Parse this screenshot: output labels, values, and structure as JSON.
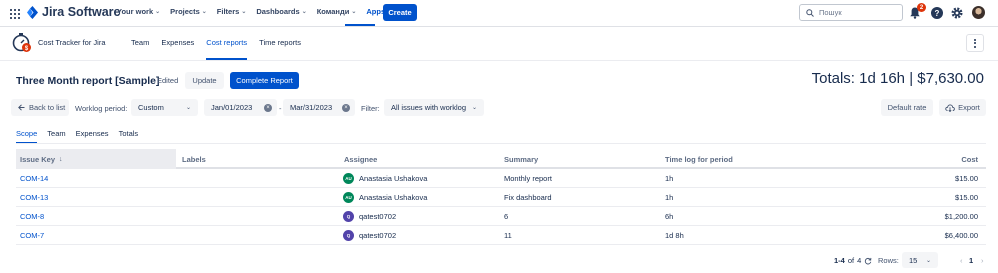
{
  "topnav": {
    "logo": "Jira Software",
    "items": [
      {
        "label": "Your work"
      },
      {
        "label": "Projects"
      },
      {
        "label": "Filters"
      },
      {
        "label": "Dashboards"
      },
      {
        "label": "Команди"
      },
      {
        "label": "Apps"
      }
    ],
    "create_label": "Create",
    "search_placeholder": "Пошук",
    "notif_count": "2",
    "help_glyph": "?"
  },
  "app": {
    "name": "Cost Tracker for Jira",
    "tabs": [
      {
        "label": "Team"
      },
      {
        "label": "Expenses"
      },
      {
        "label": "Cost reports"
      },
      {
        "label": "Time reports"
      }
    ]
  },
  "report": {
    "title": "Three Month report [Sample]",
    "status": "Edited",
    "update_label": "Update",
    "complete_label": "Complete Report",
    "totals": "Totals: 1d 16h | $7,630.00"
  },
  "filters": {
    "back_label": "Back to list",
    "worklog_label": "Worklog period:",
    "period_value": "Custom",
    "date_from": "Jan/01/2023",
    "date_sep": "-",
    "date_to": "Mar/31/2023",
    "filter_label": "Filter:",
    "filter_value": "All issues with worklog",
    "default_rate_label": "Default rate",
    "export_label": "Export"
  },
  "subtabs": [
    {
      "label": "Scope"
    },
    {
      "label": "Team"
    },
    {
      "label": "Expenses"
    },
    {
      "label": "Totals"
    }
  ],
  "table": {
    "columns": [
      "Issue Key",
      "Labels",
      "Assignee",
      "Summary",
      "Time log for period",
      "Cost"
    ],
    "rows": [
      {
        "key": "COM-14",
        "labels": "",
        "avatar": "AU",
        "avatar_color": "#00875a",
        "assignee": "Anastasia Ushakova",
        "summary": "Monthly report",
        "time": "1h",
        "cost": "$15.00"
      },
      {
        "key": "COM-13",
        "labels": "",
        "avatar": "AU",
        "avatar_color": "#00875a",
        "assignee": "Anastasia Ushakova",
        "summary": "Fix dashboard",
        "time": "1h",
        "cost": "$15.00"
      },
      {
        "key": "COM-8",
        "labels": "",
        "avatar": "Q",
        "avatar_color": "#5243aa",
        "assignee": "qatest0702",
        "summary": "6",
        "time": "6h",
        "cost": "$1,200.00"
      },
      {
        "key": "COM-7",
        "labels": "",
        "avatar": "Q",
        "avatar_color": "#5243aa",
        "assignee": "qatest0702",
        "summary": "11",
        "time": "1d 8h",
        "cost": "$6,400.00"
      }
    ]
  },
  "pagination": {
    "range": "1-4",
    "of_label": "of",
    "total": "4",
    "rows_label": "Rows:",
    "rows_value": "15",
    "current_page": "1",
    "prev_glyph": "‹",
    "next_glyph": "›"
  },
  "colors": {
    "accent": "#0052cc",
    "text": "#172b4d",
    "badge": "#de350b"
  }
}
